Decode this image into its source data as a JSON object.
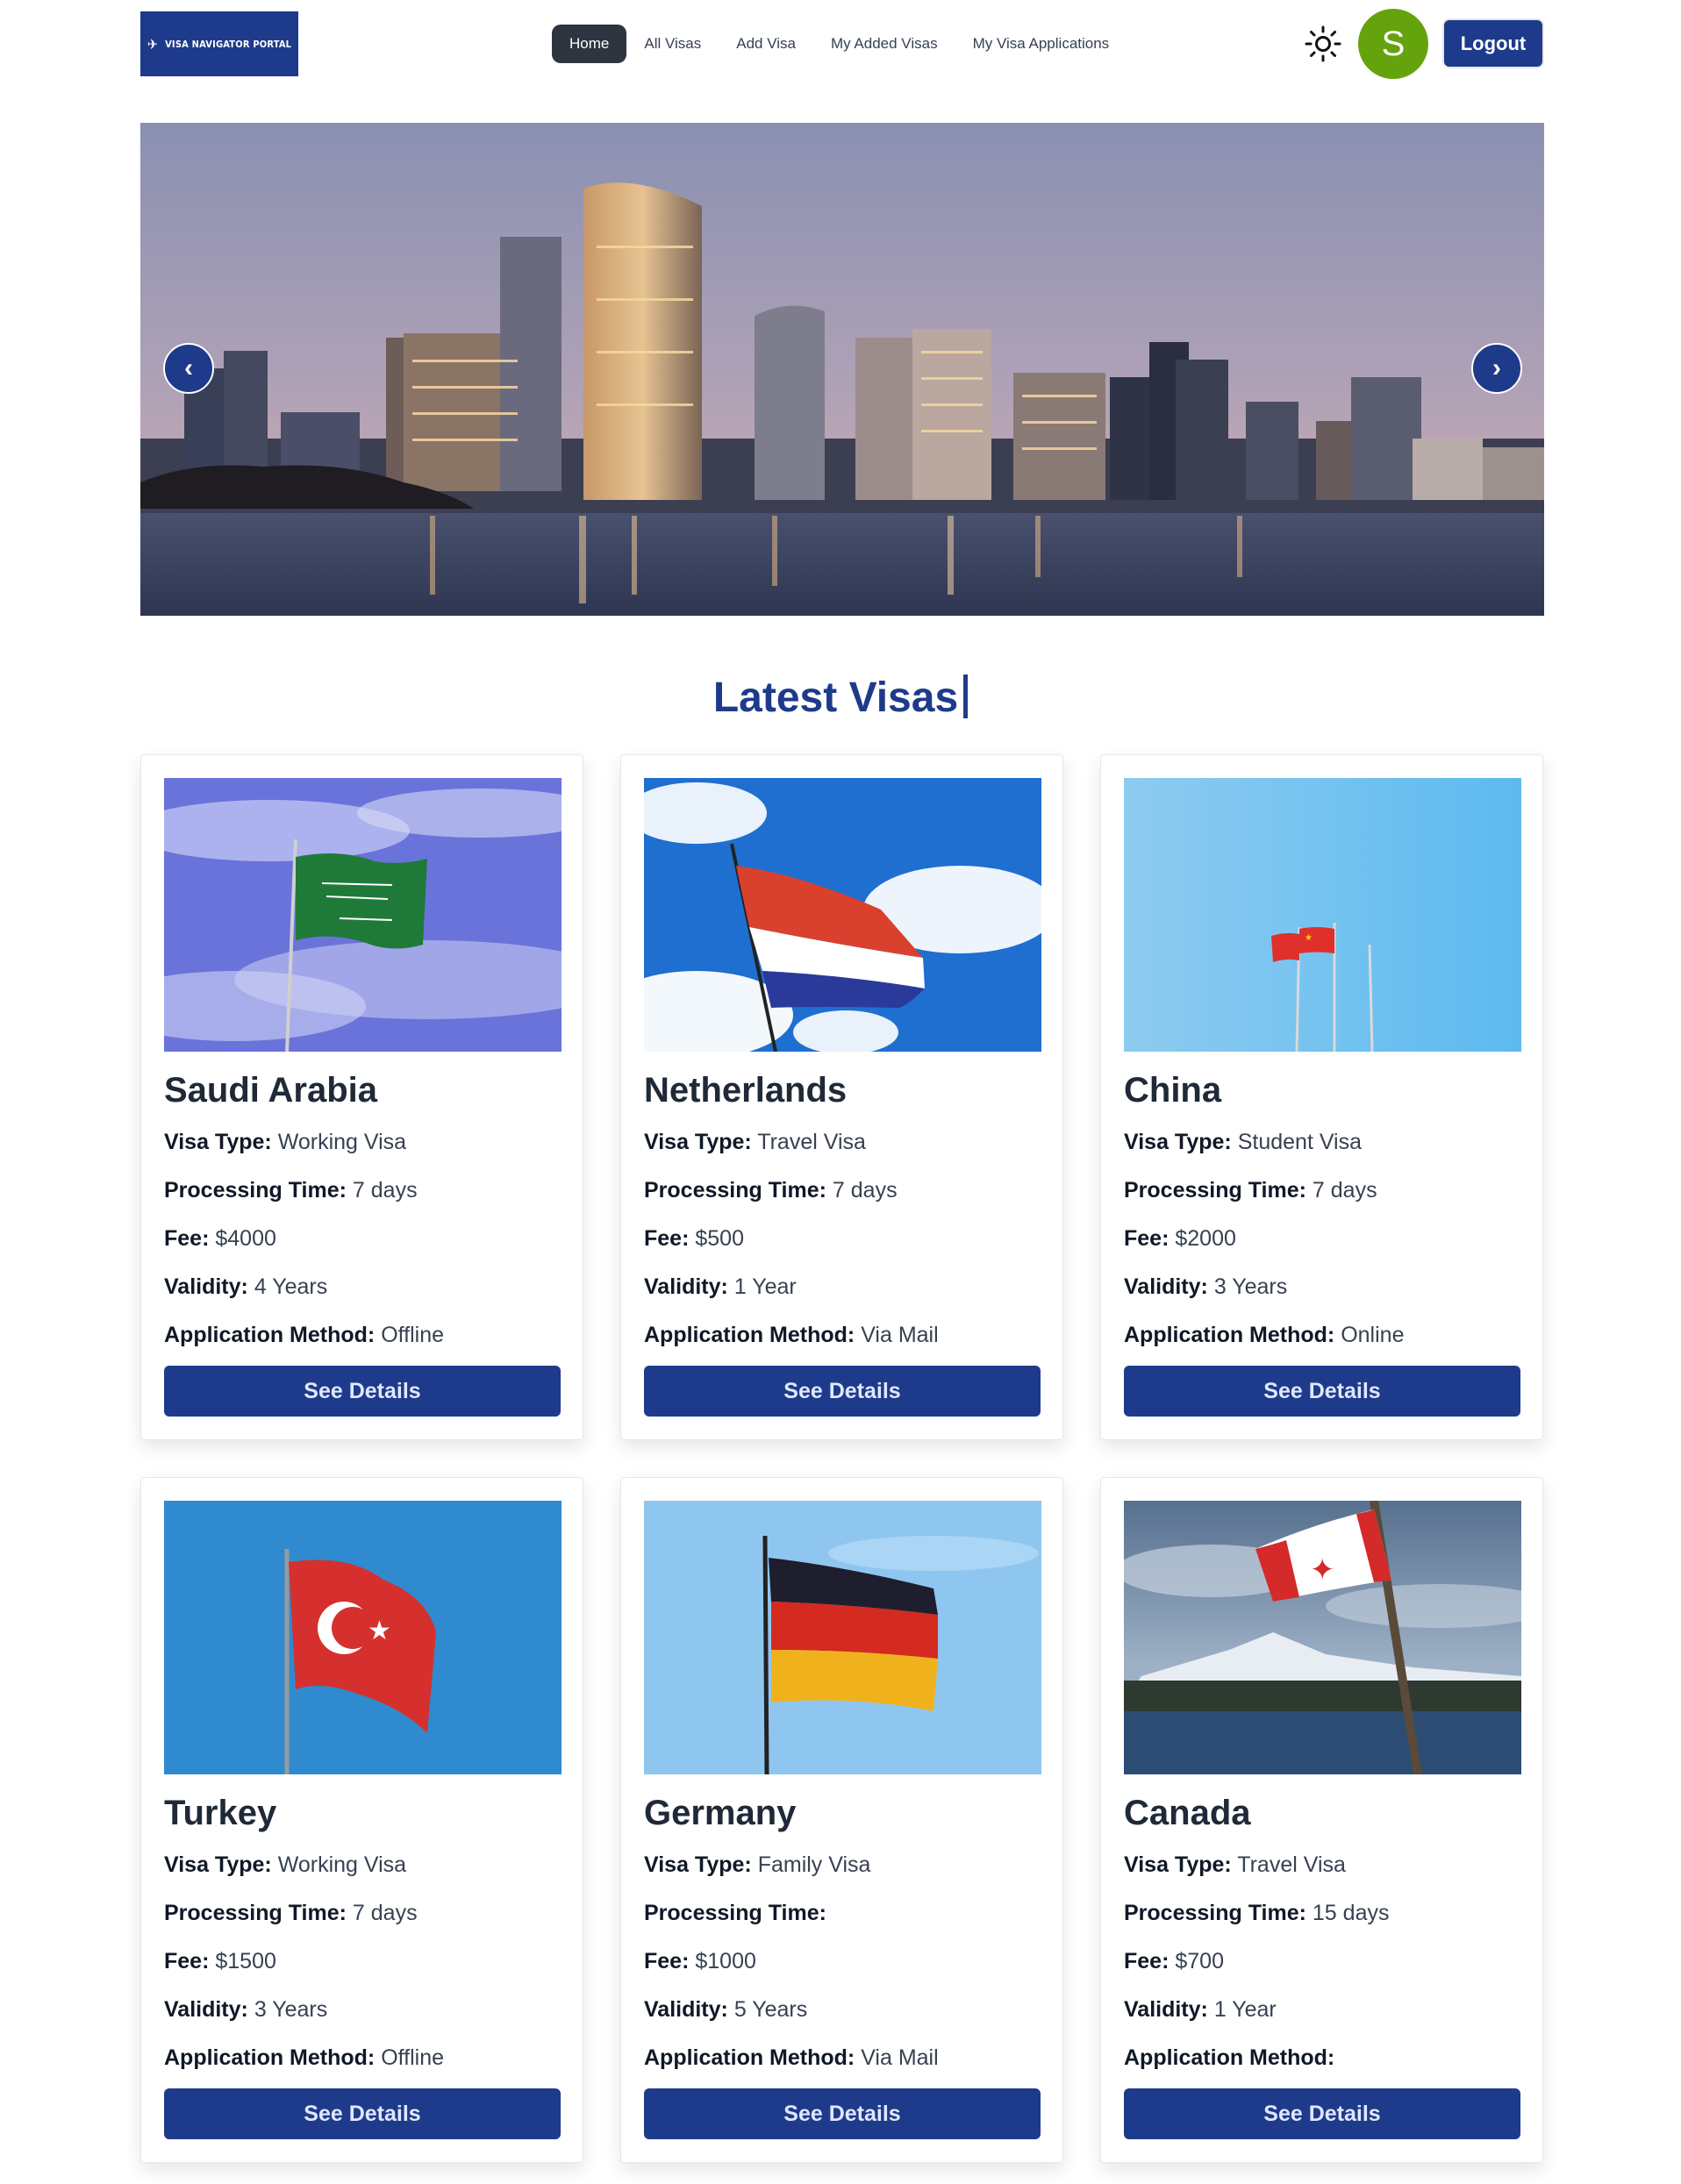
{
  "nav": {
    "logo_text": "VISA NAVIGATOR PORTAL",
    "links": [
      "Home",
      "All Visas",
      "Add Visa",
      "My Added Visas",
      "My Visa Applications"
    ],
    "active_link": "Home",
    "avatar_initial": "S",
    "logout_label": "Logout"
  },
  "hero": {
    "prev_glyph": "‹",
    "next_glyph": "›"
  },
  "section": {
    "title": "Latest Visas"
  },
  "labels": {
    "visa_type": "Visa Type:",
    "processing_time": "Processing Time:",
    "fee": "Fee:",
    "validity": "Validity:",
    "application_method": "Application Method:",
    "button": "See Details"
  },
  "visas": [
    {
      "country": "Saudi Arabia",
      "visa_type": "Working Visa",
      "processing_time": "7 days",
      "fee": "$4000",
      "validity": "4 Years",
      "application_method": "Offline"
    },
    {
      "country": "Netherlands",
      "visa_type": "Travel Visa",
      "processing_time": "7 days",
      "fee": "$500",
      "validity": "1 Year",
      "application_method": "Via Mail"
    },
    {
      "country": "China",
      "visa_type": "Student Visa",
      "processing_time": "7 days",
      "fee": "$2000",
      "validity": "3 Years",
      "application_method": "Online"
    },
    {
      "country": "Turkey",
      "visa_type": "Working Visa",
      "processing_time": "7 days",
      "fee": "$1500",
      "validity": "3 Years",
      "application_method": "Offline"
    },
    {
      "country": "Germany",
      "visa_type": "Family Visa",
      "processing_time": "",
      "fee": "$1000",
      "validity": "5 Years",
      "application_method": "Via Mail"
    },
    {
      "country": "Canada",
      "visa_type": "Travel Visa",
      "processing_time": "15 days",
      "fee": "$700",
      "validity": "1 Year",
      "application_method": ""
    }
  ],
  "colors": {
    "primary": "#1e3a8a",
    "avatar": "#65a30d",
    "active_nav": "#2d3540"
  }
}
